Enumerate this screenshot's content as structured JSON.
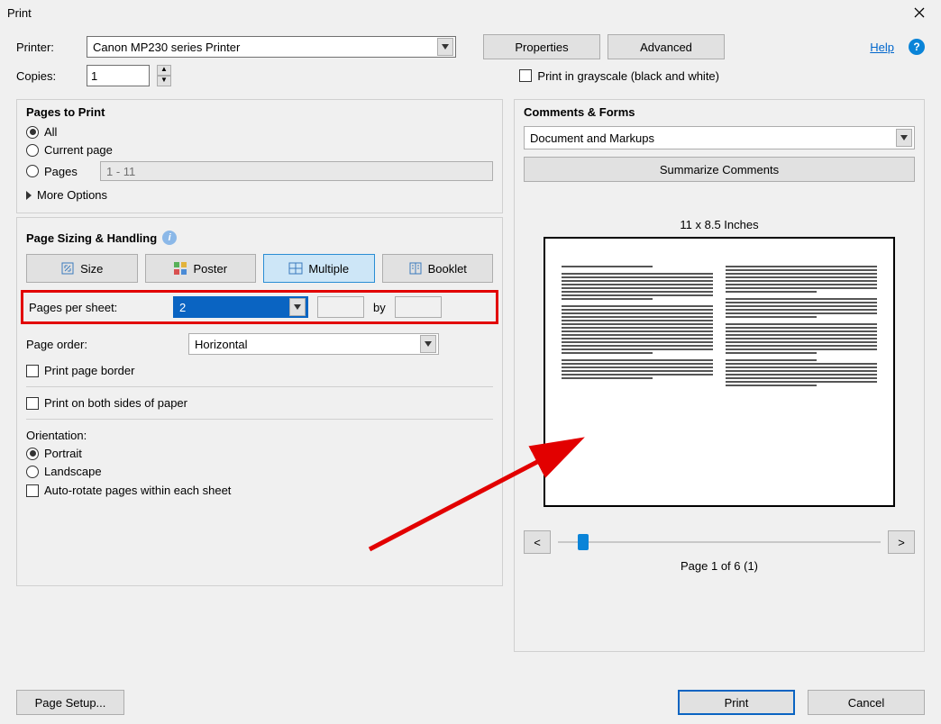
{
  "title": "Print",
  "printer_label": "Printer:",
  "printer_value": "Canon MP230 series Printer",
  "properties_btn": "Properties",
  "advanced_btn": "Advanced",
  "help_link": "Help",
  "copies_label": "Copies:",
  "copies_value": "1",
  "grayscale_label": "Print in grayscale (black and white)",
  "left": {
    "pages_title": "Pages to Print",
    "all": "All",
    "current": "Current page",
    "pages_radio": "Pages",
    "pages_range": "1 - 11",
    "more": "More Options",
    "sizing_title": "Page Sizing & Handling",
    "tab_size": "Size",
    "tab_poster": "Poster",
    "tab_multiple": "Multiple",
    "tab_booklet": "Booklet",
    "pps_label": "Pages per sheet:",
    "pps_value": "2",
    "by_label": "by",
    "order_label": "Page order:",
    "order_value": "Horizontal",
    "border_label": "Print page border",
    "duplex_label": "Print on both sides of paper",
    "orient_label": "Orientation:",
    "portrait": "Portrait",
    "landscape": "Landscape",
    "autorotate": "Auto-rotate pages within each sheet"
  },
  "right": {
    "cf_title": "Comments & Forms",
    "cf_value": "Document and Markups",
    "summarize": "Summarize Comments",
    "paper_dims": "11 x 8.5 Inches",
    "prev": "<",
    "next": ">",
    "page_counter": "Page 1 of 6 (1)"
  },
  "footer": {
    "pagesetup": "Page Setup...",
    "print": "Print",
    "cancel": "Cancel"
  }
}
